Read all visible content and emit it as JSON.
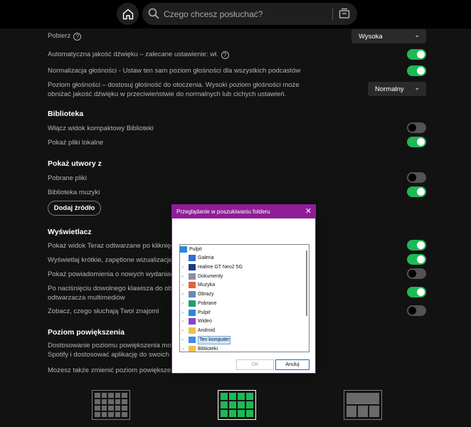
{
  "header": {
    "search_placeholder": "Czego chcesz posłuchać?",
    "icons": [
      "home-icon",
      "search-icon",
      "browse-icon"
    ]
  },
  "settings": {
    "download": {
      "label": "Pobierz",
      "value": "Wysoka"
    },
    "auto_quality": {
      "label": "Automatyczna jakość dźwięku – zalecane ustawienie: wł.",
      "on": true
    },
    "normalization": {
      "label": "Normalizacja głośności - Ustaw ten sam poziom głośności dla wszystkich podcastów",
      "on": true
    },
    "volume_level": {
      "label_line1": "Poziom głośności – dostosuj głośność do otoczenia. Wysoki poziom głośności może",
      "label_line2": "obniżać jakość dźwięku w przeciwieństwie do normalnych lub cichych ustawień.",
      "value": "Normalny"
    }
  },
  "library": {
    "title": "Biblioteka",
    "compact": {
      "label": "Włącz widok kompaktowy Biblioteki",
      "on": false
    },
    "local_files": {
      "label": "Pokaż pliki lokalne",
      "on": true
    }
  },
  "show_from": {
    "title": "Pokaż utwory z",
    "downloads": {
      "label": "Pobrane pliki",
      "on": false
    },
    "music_library": {
      "label": "Biblioteka muzyki",
      "on": true
    },
    "add_source": "Dodaj źródło"
  },
  "display": {
    "title": "Wyświetlacz",
    "now_playing": {
      "label": "Pokaż widok Teraz odtwarzane po kliknięciu",
      "on": true
    },
    "canvas": {
      "label": "Wyświetlaj krótkie, zapętlone wizualizacje p",
      "on": true
    },
    "release_notif": {
      "label": "Pokaż powiadomienia o nowych wydaniach",
      "on": false
    },
    "media_key_line1": "Po naciśnięciu dowolnego klawisza do obsł",
    "media_key_line2": "odtwarzacza multimediów",
    "media_key_on": true,
    "friends": {
      "label": "Zobacz, czego słuchają Twoi znajomi",
      "on": false
    }
  },
  "zoom": {
    "title": "Poziom powiększenia",
    "desc_line1": "Dostosowanie poziomu powiększenia moż",
    "desc_line2": "Spotify i dostosować aplikację do swoich pr",
    "desc_line3": "Możesz także zmienić poziom powiększenia",
    "selected_level": 2
  },
  "dialog": {
    "title": "Przeglądanie w poszukiwaniu folderu",
    "root": "Pulpit",
    "items": [
      {
        "label": "Galeria",
        "icon": "gallery-icon",
        "expandable": false,
        "color": "#2f6fd6"
      },
      {
        "label": "realme GT Neo2 5G",
        "icon": "phone-icon",
        "expandable": true,
        "color": "#1a3a8a"
      },
      {
        "label": "Dokumenty",
        "icon": "documents-icon",
        "expandable": true,
        "color": "#8a8fa8"
      },
      {
        "label": "Muzyka",
        "icon": "music-icon",
        "expandable": true,
        "color": "#e0633a"
      },
      {
        "label": "Obrazy",
        "icon": "pictures-icon",
        "expandable": true,
        "color": "#6a86b8"
      },
      {
        "label": "Pobrane",
        "icon": "downloads-icon",
        "expandable": true,
        "color": "#1e9e6a"
      },
      {
        "label": "Pulpit",
        "icon": "desktop-icon",
        "expandable": true,
        "color": "#2d87d8"
      },
      {
        "label": "Wideo",
        "icon": "video-icon",
        "expandable": true,
        "color": "#8a3fd6"
      },
      {
        "label": "Android",
        "icon": "folder-icon",
        "expandable": true,
        "color": "#f2c14e"
      },
      {
        "label": "Ten komputer",
        "icon": "computer-icon",
        "expandable": true,
        "color": "#3b8fe0",
        "selected": true
      },
      {
        "label": "Biblioteki",
        "icon": "folder-icon",
        "expandable": true,
        "color": "#f2c14e"
      }
    ],
    "ok": "OK",
    "cancel": "Anuluj"
  }
}
